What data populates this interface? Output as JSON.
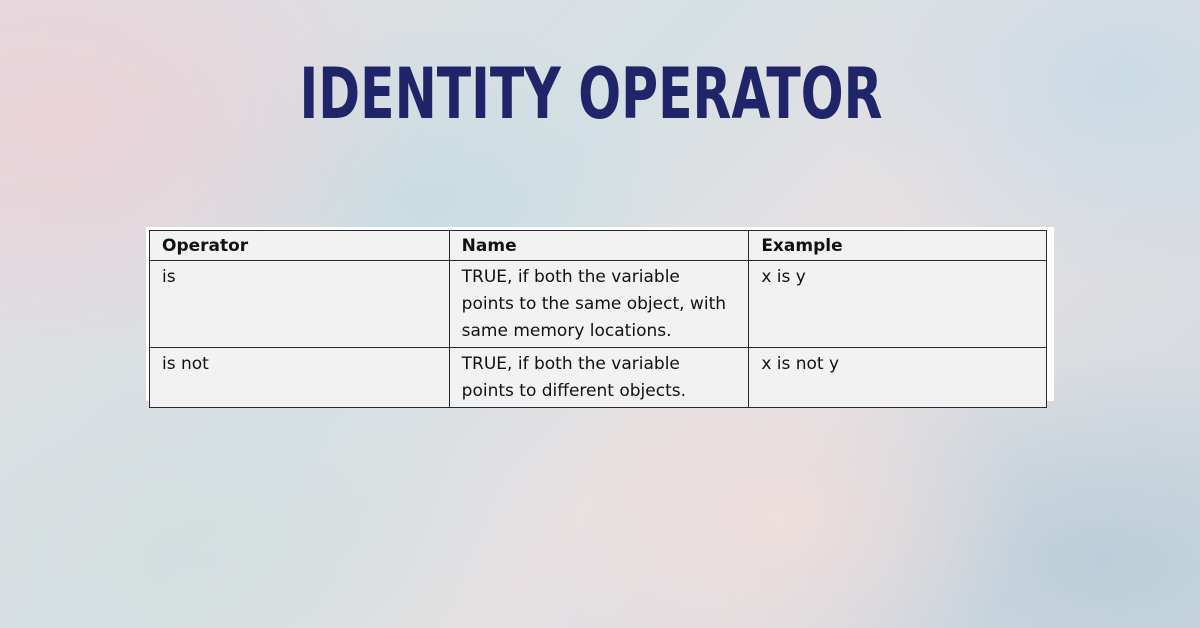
{
  "title": "IDENTITY OPERATOR",
  "table": {
    "headers": [
      "Operator",
      "Name",
      "Example"
    ],
    "rows": [
      {
        "operator": "is",
        "name": "TRUE, if both the variable points to the same object, with same memory locations.",
        "example": "x is y"
      },
      {
        "operator": "is not",
        "name": "TRUE, if both the variable points to different objects.",
        "example": "x is not y"
      }
    ]
  },
  "colors": {
    "title": "#1f2568",
    "table_background": "#f2f2f2",
    "border": "#2a2a2a"
  }
}
